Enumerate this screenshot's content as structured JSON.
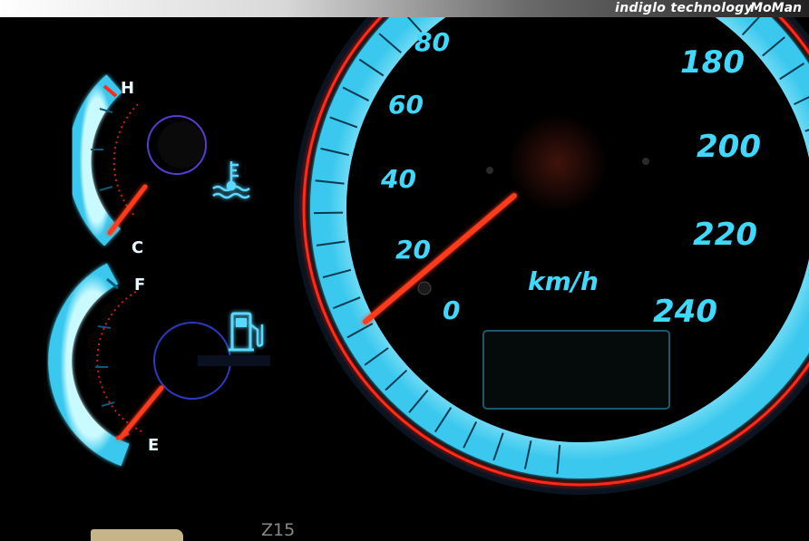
{
  "banner": {
    "text": "indiglo technology",
    "brand": "MoMan"
  },
  "speedometer": {
    "labels": [
      "0",
      "20",
      "40",
      "60",
      "80",
      "180",
      "200",
      "220",
      "240"
    ],
    "unit": "km/h",
    "needle_value_kmh": 9
  },
  "temp_gauge": {
    "high_label": "H",
    "low_label": "C",
    "icon": "coolant-temperature-icon",
    "needle_level": 0.15
  },
  "fuel_gauge": {
    "full_label": "F",
    "empty_label": "E",
    "icon": "fuel-pump-icon",
    "needle_level": 0.12
  },
  "footer": {
    "code": "Z15"
  },
  "colors": {
    "glow": "#40e0ff",
    "needle": "#ff3a1a",
    "red_ring": "#ff2a1a",
    "face": "#9ef3ff"
  }
}
